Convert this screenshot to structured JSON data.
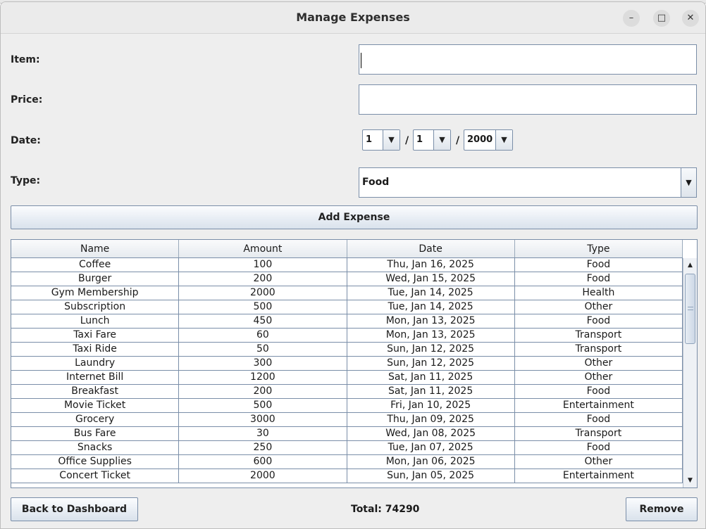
{
  "window": {
    "title": "Manage Expenses",
    "minimize_icon": "–",
    "maximize_icon": "□",
    "close_icon": "✕"
  },
  "form": {
    "item_label": "Item:",
    "item_value": "",
    "price_label": "Price:",
    "price_value": "",
    "date_label": "Date:",
    "date_day": "1",
    "date_month": "1",
    "date_year": "2000",
    "date_separator": "/",
    "type_label": "Type:",
    "type_value": "Food",
    "add_button": "Add Expense"
  },
  "table": {
    "columns": [
      "Name",
      "Amount",
      "Date",
      "Type"
    ],
    "rows": [
      [
        "Coffee",
        "100",
        "Thu, Jan 16, 2025",
        "Food"
      ],
      [
        "Burger",
        "200",
        "Wed, Jan 15, 2025",
        "Food"
      ],
      [
        "Gym Membership",
        "2000",
        "Tue, Jan 14, 2025",
        "Health"
      ],
      [
        "Subscription",
        "500",
        "Tue, Jan 14, 2025",
        "Other"
      ],
      [
        "Lunch",
        "450",
        "Mon, Jan 13, 2025",
        "Food"
      ],
      [
        "Taxi Fare",
        "60",
        "Mon, Jan 13, 2025",
        "Transport"
      ],
      [
        "Taxi Ride",
        "50",
        "Sun, Jan 12, 2025",
        "Transport"
      ],
      [
        "Laundry",
        "300",
        "Sun, Jan 12, 2025",
        "Other"
      ],
      [
        "Internet Bill",
        "1200",
        "Sat, Jan 11, 2025",
        "Other"
      ],
      [
        "Breakfast",
        "200",
        "Sat, Jan 11, 2025",
        "Food"
      ],
      [
        "Movie Ticket",
        "500",
        "Fri, Jan 10, 2025",
        "Entertainment"
      ],
      [
        "Grocery",
        "3000",
        "Thu, Jan 09, 2025",
        "Food"
      ],
      [
        "Bus Fare",
        "30",
        "Wed, Jan 08, 2025",
        "Transport"
      ],
      [
        "Snacks",
        "250",
        "Tue, Jan 07, 2025",
        "Food"
      ],
      [
        "Office Supplies",
        "600",
        "Mon, Jan 06, 2025",
        "Other"
      ],
      [
        "Concert Ticket",
        "2000",
        "Sun, Jan 05, 2025",
        "Entertainment"
      ]
    ]
  },
  "footer": {
    "back_button": "Back to Dashboard",
    "total": "Total: 74290",
    "remove_button": "Remove"
  },
  "icons": {
    "dropdown": "▼",
    "scroll_up": "▲",
    "scroll_down": "▼"
  }
}
